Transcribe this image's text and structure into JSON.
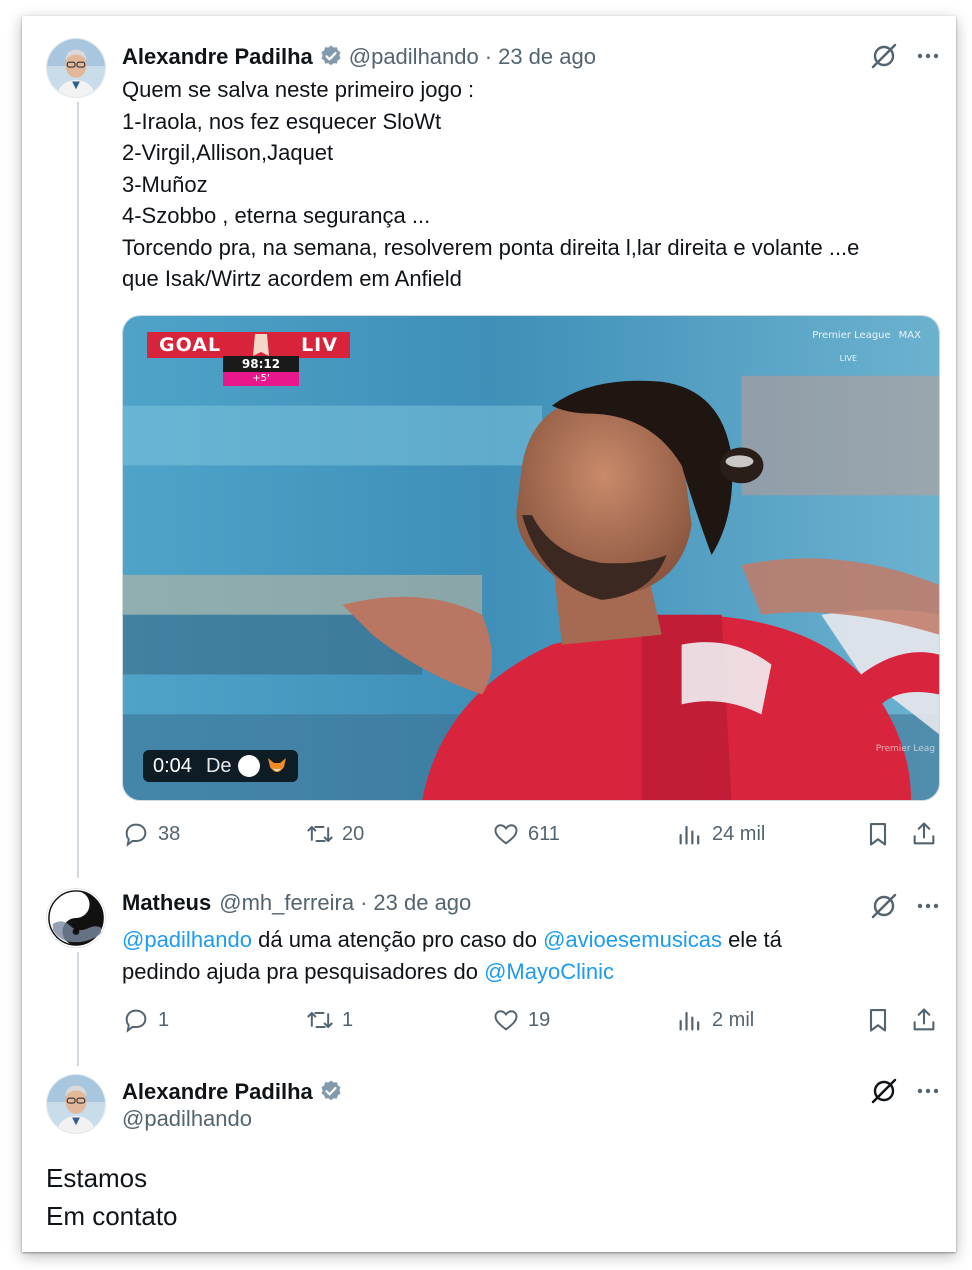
{
  "tweets": [
    {
      "author": "Alexandre Padilha",
      "handle": "@padilhando",
      "separator": "·",
      "date": "23 de ago",
      "lines": [
        "Quem se salva neste primeiro jogo :",
        "1-Iraola, nos fez esquecer SloWt",
        "2-Virgil,Allison,Jaquet",
        "3-Muñoz",
        "4-Szobbo , eterna segurança ...",
        "Torcendo pra, na semana, resolverem ponta direita l,lar direita e volante ...e",
        "que Isak/Wirtz acordem em Anfield"
      ],
      "media": {
        "score_left": "GOAL",
        "score_right": "LIV",
        "clock": "98:12",
        "added_time": "+5'",
        "broadcaster_left": "Premier League",
        "broadcaster_right": "MAX",
        "live": "LIVE",
        "watermark": "Premier Leag",
        "duration": "0:04",
        "from_label": "De"
      },
      "stats": {
        "replies": "38",
        "reposts": "20",
        "likes": "611",
        "views": "24 mil"
      }
    },
    {
      "author": "Matheus",
      "handle": "@mh_ferreira",
      "separator": "·",
      "date": "23 de ago",
      "line1": {
        "mention1": "@padilhando",
        "text1": " dá uma atenção pro caso do ",
        "mention2": "@avioesemusicas",
        "text2": " ele tá"
      },
      "line2": {
        "text": "pedindo ajuda pra pesquisadores do ",
        "mention": "@MayoClinic"
      },
      "stats": {
        "replies": "1",
        "reposts": "1",
        "likes": "19",
        "views": "2 mil"
      }
    },
    {
      "author": "Alexandre Padilha",
      "handle": "@padilhando",
      "lines": [
        "Estamos",
        "Em contato"
      ]
    }
  ],
  "colors": {
    "accent": "#1d9bf0",
    "muted": "#536471",
    "verified": "#829aab"
  }
}
